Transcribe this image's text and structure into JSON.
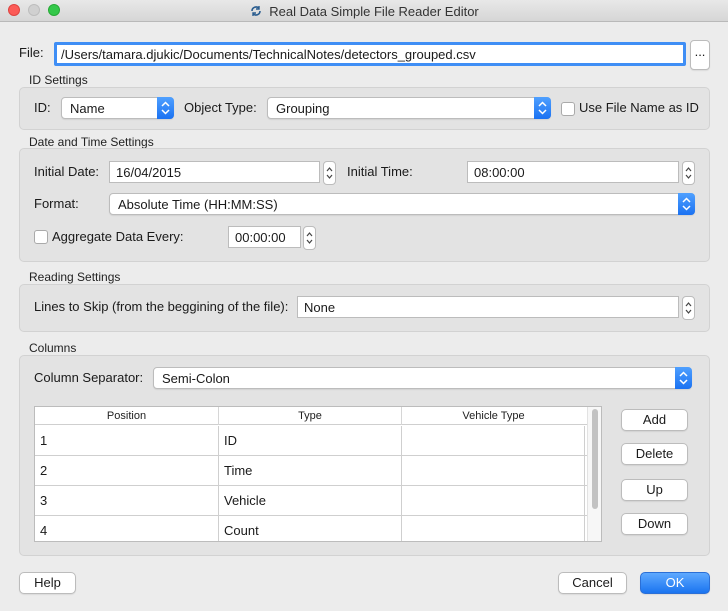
{
  "window": {
    "title": "Real Data Simple File Reader Editor"
  },
  "file": {
    "label": "File:",
    "path": "/Users/tamara.djukic/Documents/TechnicalNotes/detectors_grouped.csv",
    "browse_label": "..."
  },
  "id_settings": {
    "section_label": "ID Settings",
    "id_label": "ID:",
    "id_value": "Name",
    "object_type_label": "Object Type:",
    "object_type_value": "Grouping",
    "use_file_name_label": "Use File Name as ID",
    "use_file_name_checked": false
  },
  "date_time": {
    "section_label": "Date and Time Settings",
    "initial_date_label": "Initial Date:",
    "initial_date_value": "16/04/2015",
    "initial_time_label": "Initial Time:",
    "initial_time_value": "08:00:00",
    "format_label": "Format:",
    "format_value": "Absolute Time (HH:MM:SS)",
    "aggregate_label": "Aggregate Data Every:",
    "aggregate_checked": false,
    "aggregate_value": "00:00:00"
  },
  "reading": {
    "section_label": "Reading Settings",
    "lines_to_skip_label": "Lines to Skip (from the beggining of the file):",
    "lines_to_skip_value": "None"
  },
  "columns": {
    "section_label": "Columns",
    "separator_label": "Column Separator:",
    "separator_value": "Semi-Colon",
    "headers": [
      "Position",
      "Type",
      "Vehicle Type"
    ],
    "rows": [
      {
        "position": "1",
        "type": "ID",
        "vehicle_type": ""
      },
      {
        "position": "2",
        "type": "Time",
        "vehicle_type": ""
      },
      {
        "position": "3",
        "type": "Vehicle",
        "vehicle_type": ""
      },
      {
        "position": "4",
        "type": "Count",
        "vehicle_type": ""
      }
    ],
    "buttons": {
      "add": "Add",
      "delete": "Delete",
      "up": "Up",
      "down": "Down"
    }
  },
  "footer": {
    "help": "Help",
    "cancel": "Cancel",
    "ok": "OK"
  },
  "colors": {
    "accent": "#1a74f0",
    "focus_ring": "#3f8ef5",
    "background": "#ececec"
  }
}
